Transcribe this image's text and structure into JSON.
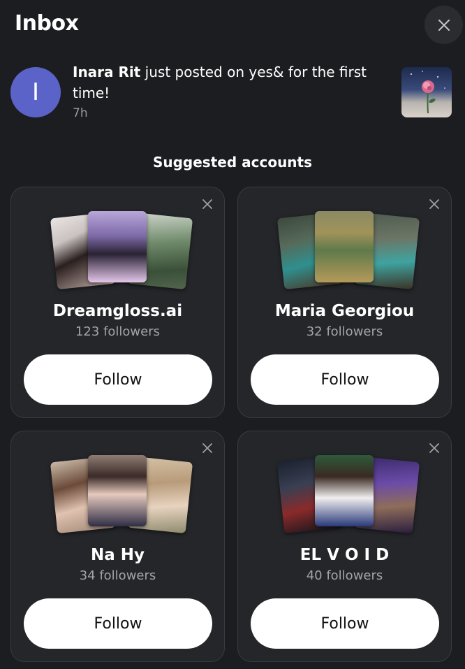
{
  "header": {
    "title": "Inbox"
  },
  "notification": {
    "avatar_initial": "I",
    "actor": "Inara Rit",
    "message": " just posted on yes& for the first time!",
    "time": "7h"
  },
  "section_title": "Suggested accounts",
  "accounts": [
    {
      "name": "Dreamgloss.ai",
      "followers": "123 followers",
      "follow_label": "Follow"
    },
    {
      "name": "Maria Georgiou",
      "followers": "32 followers",
      "follow_label": "Follow"
    },
    {
      "name": "Na Hy",
      "followers": "34 followers",
      "follow_label": "Follow"
    },
    {
      "name": "EL V O I D",
      "followers": "40 followers",
      "follow_label": "Follow"
    }
  ],
  "colors": {
    "background": "#1c1d20",
    "card": "#25262a",
    "avatar": "#5b63c9",
    "button": "#ffffff"
  }
}
